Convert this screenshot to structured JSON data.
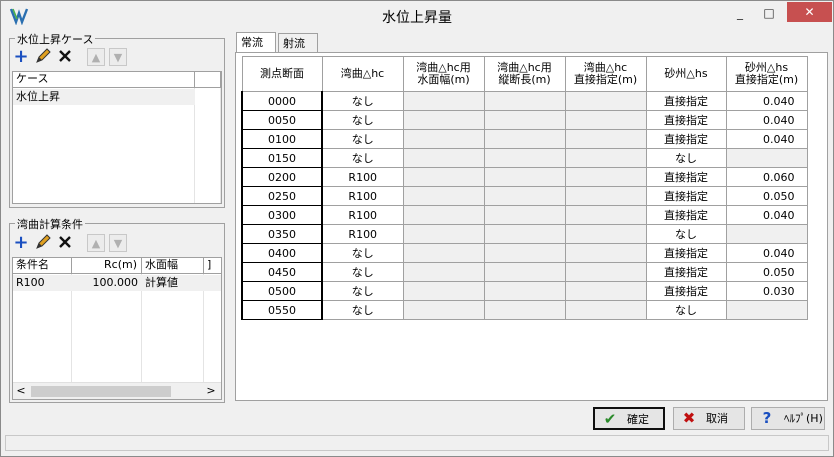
{
  "window": {
    "title": "水位上昇量",
    "minimize_glyph": "_",
    "maximize_glyph": "□",
    "close_glyph": "✕"
  },
  "case_group": {
    "title": "水位上昇ケース",
    "toolbar": {
      "add_icon": "plus-icon",
      "edit_icon": "pencil-icon",
      "delete_icon": "x-icon",
      "up_icon": "arrow-up-icon",
      "down_icon": "arrow-down-icon"
    },
    "header": [
      "ケース",
      ""
    ],
    "rows": [
      [
        "水位上昇"
      ]
    ]
  },
  "curve_group": {
    "title": "湾曲計算条件",
    "header": [
      "条件名",
      "Rc(m)",
      "水面幅",
      "]"
    ],
    "rows": [
      [
        "R100",
        "100.000",
        "計算値"
      ]
    ],
    "scroll_left": "<",
    "scroll_right": ">"
  },
  "tabs": [
    "常流",
    "射流"
  ],
  "grid": {
    "headers": [
      "測点断面",
      "湾曲△hc",
      "湾曲△hc用\n水面幅(m)",
      "湾曲△hc用\n縦断長(m)",
      "湾曲△hc\n直接指定(m)",
      "砂州△hs",
      "砂州△hs\n直接指定(m)"
    ],
    "rows": [
      {
        "station": "0000",
        "hc": "なし",
        "hs": "直接指定",
        "hs_val": "0.040"
      },
      {
        "station": "0050",
        "hc": "なし",
        "hs": "直接指定",
        "hs_val": "0.040"
      },
      {
        "station": "0100",
        "hc": "なし",
        "hs": "直接指定",
        "hs_val": "0.040"
      },
      {
        "station": "0150",
        "hc": "なし",
        "hs": "なし",
        "hs_val": ""
      },
      {
        "station": "0200",
        "hc": "R100",
        "hs": "直接指定",
        "hs_val": "0.060"
      },
      {
        "station": "0250",
        "hc": "R100",
        "hs": "直接指定",
        "hs_val": "0.050"
      },
      {
        "station": "0300",
        "hc": "R100",
        "hs": "直接指定",
        "hs_val": "0.040"
      },
      {
        "station": "0350",
        "hc": "R100",
        "hs": "なし",
        "hs_val": ""
      },
      {
        "station": "0400",
        "hc": "なし",
        "hs": "直接指定",
        "hs_val": "0.040"
      },
      {
        "station": "0450",
        "hc": "なし",
        "hs": "直接指定",
        "hs_val": "0.050"
      },
      {
        "station": "0500",
        "hc": "なし",
        "hs": "直接指定",
        "hs_val": "0.030"
      },
      {
        "station": "0550",
        "hc": "なし",
        "hs": "なし",
        "hs_val": ""
      }
    ]
  },
  "buttons": {
    "ok": "確定",
    "cancel": "取消",
    "help": "ﾍﾙﾌﾟ(H)",
    "ok_icon": "check-icon",
    "cancel_icon": "x-icon",
    "help_icon": "question-icon"
  },
  "colors": {
    "close_button": "#c75050",
    "add_icon": "#1a4fc0",
    "check": "#2a8a2a",
    "cancel_x": "#c01010",
    "help_q": "#1a4fc0"
  }
}
